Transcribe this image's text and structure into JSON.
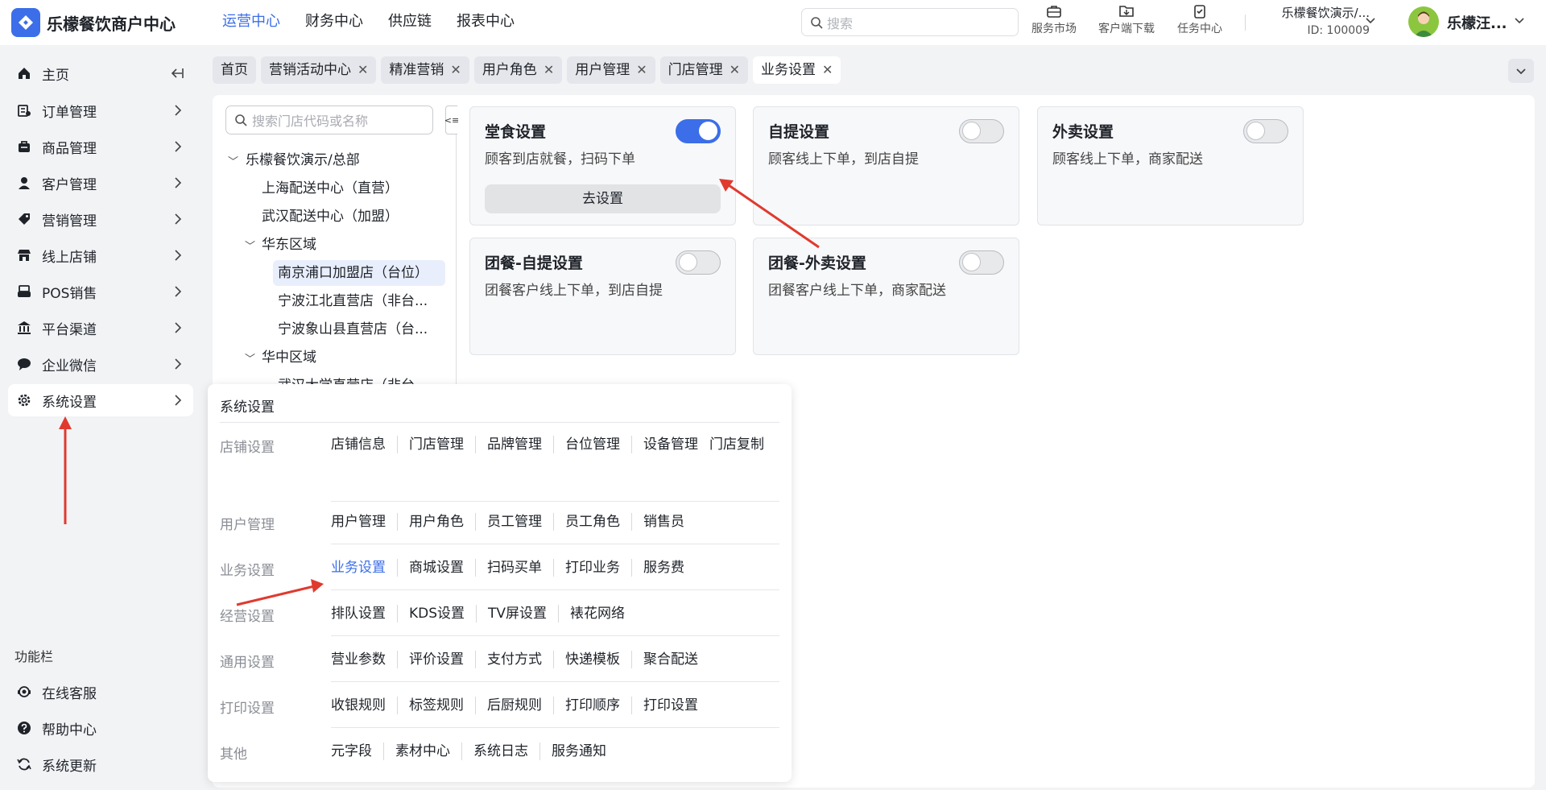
{
  "brand": {
    "name": "乐檬餐饮商户中心",
    "accent": "#3b6ee8"
  },
  "top_nav": [
    {
      "label": "运营中心",
      "active": true
    },
    {
      "label": "财务中心",
      "active": false
    },
    {
      "label": "供应链",
      "active": false
    },
    {
      "label": "报表中心",
      "active": false
    }
  ],
  "search": {
    "placeholder": "搜索"
  },
  "top_icons": [
    {
      "label": "服务市场",
      "icon": "briefcase-icon"
    },
    {
      "label": "客户端下载",
      "icon": "folder-download-icon"
    },
    {
      "label": "任务中心",
      "icon": "clipboard-icon"
    }
  ],
  "org": {
    "name": "乐檬餐饮演示/...",
    "id_text": "ID: 100009"
  },
  "user": {
    "name": "乐檬汪..."
  },
  "sidebar": {
    "items": [
      {
        "label": "主页",
        "icon": "home-icon"
      },
      {
        "label": "订单管理",
        "icon": "order-icon"
      },
      {
        "label": "商品管理",
        "icon": "product-icon"
      },
      {
        "label": "客户管理",
        "icon": "user-icon"
      },
      {
        "label": "营销管理",
        "icon": "tag-icon"
      },
      {
        "label": "线上店铺",
        "icon": "store-icon"
      },
      {
        "label": "POS销售",
        "icon": "pos-icon"
      },
      {
        "label": "平台渠道",
        "icon": "bank-icon"
      },
      {
        "label": "企业微信",
        "icon": "chat-icon"
      },
      {
        "label": "系统设置",
        "icon": "gear-icon",
        "active": true
      }
    ],
    "function_title": "功能栏",
    "function_items": [
      {
        "label": "在线客服",
        "icon": "headset-icon"
      },
      {
        "label": "帮助中心",
        "icon": "help-icon"
      },
      {
        "label": "系统更新",
        "icon": "refresh-icon"
      }
    ]
  },
  "tabs": [
    {
      "label": "首页",
      "closable": false,
      "active": false
    },
    {
      "label": "营销活动中心",
      "closable": true,
      "active": false
    },
    {
      "label": "精准营销",
      "closable": true,
      "active": false
    },
    {
      "label": "用户角色",
      "closable": true,
      "active": false
    },
    {
      "label": "用户管理",
      "closable": true,
      "active": false
    },
    {
      "label": "门店管理",
      "closable": true,
      "active": false
    },
    {
      "label": "业务设置",
      "closable": true,
      "active": true
    }
  ],
  "tree": {
    "search_placeholder": "搜索门店代码或名称",
    "collapse_glyph": "<≡",
    "nodes": [
      {
        "label": "乐檬餐饮演示/总部",
        "expanded": true
      },
      {
        "label": "上海配送中心（直营）"
      },
      {
        "label": "武汉配送中心（加盟）"
      },
      {
        "label": "华东区域",
        "expanded": true
      },
      {
        "label": "南京浦口加盟店（台位）",
        "selected": true
      },
      {
        "label": "宁波江北直营店（非台..."
      },
      {
        "label": "宁波象山县直营店（台..."
      },
      {
        "label": "华中区域",
        "expanded": true
      },
      {
        "label": "武汉大学直营店（非台..."
      }
    ]
  },
  "cards": [
    {
      "title": "堂食设置",
      "desc": "顾客到店就餐，扫码下单",
      "enabled": true,
      "button": "去设置"
    },
    {
      "title": "自提设置",
      "desc": "顾客线上下单，到店自提",
      "enabled": false
    },
    {
      "title": "外卖设置",
      "desc": "顾客线上下单，商家配送",
      "enabled": false
    },
    {
      "title": "团餐-自提设置",
      "desc": "团餐客户线上下单，到店自提",
      "enabled": false
    },
    {
      "title": "团餐-外卖设置",
      "desc": "团餐客户线上下单，商家配送",
      "enabled": false
    }
  ],
  "mega_menu": {
    "title": "系统设置",
    "rows": [
      {
        "category": "店铺设置",
        "links": [
          "店铺信息",
          "门店管理",
          "品牌管理",
          "台位管理",
          "设备管理",
          "门店复制"
        ]
      },
      {
        "category": "用户管理",
        "links": [
          "用户管理",
          "用户角色",
          "员工管理",
          "员工角色",
          "销售员"
        ]
      },
      {
        "category": "业务设置",
        "links": [
          "业务设置",
          "商城设置",
          "扫码买单",
          "打印业务",
          "服务费"
        ],
        "active_link": "业务设置"
      },
      {
        "category": "经营设置",
        "links": [
          "排队设置",
          "KDS设置",
          "TV屏设置",
          "裱花网络"
        ]
      },
      {
        "category": "通用设置",
        "links": [
          "营业参数",
          "评价设置",
          "支付方式",
          "快递模板",
          "聚合配送"
        ]
      },
      {
        "category": "打印设置",
        "links": [
          "收银规则",
          "标签规则",
          "后厨规则",
          "打印顺序",
          "打印设置"
        ]
      },
      {
        "category": "其他",
        "links": [
          "元字段",
          "素材中心",
          "系统日志",
          "服务通知"
        ]
      }
    ]
  },
  "annotation_color": "#e03a2f"
}
